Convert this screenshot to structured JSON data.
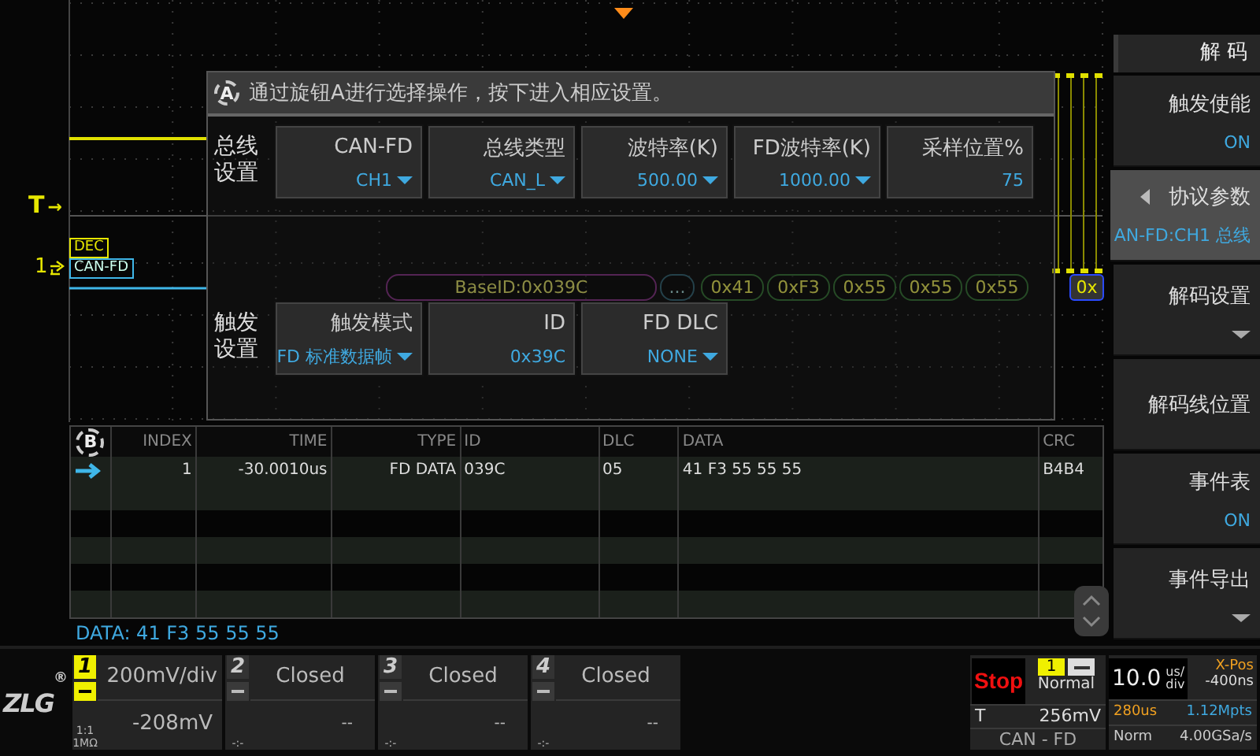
{
  "waveform": {
    "trigger_label": "T",
    "trigger_arrow": "→",
    "channel_label": "1",
    "decode_tags": [
      "DEC",
      "CAN-FD"
    ],
    "bus_segments": [
      {
        "kind": "id",
        "text": "BaseID:0x039C"
      },
      {
        "kind": "ctrl",
        "text": "..."
      },
      {
        "kind": "data",
        "text": "0x41"
      },
      {
        "kind": "data",
        "text": "0xF3"
      },
      {
        "kind": "data",
        "text": "0x55"
      },
      {
        "kind": "data",
        "text": "0x55"
      },
      {
        "kind": "data",
        "text": "0x55"
      },
      {
        "kind": "crc",
        "text": "0x"
      }
    ]
  },
  "dialog": {
    "knob_letter": "A",
    "hint": "通过旋钮A进行选择操作，按下进入相应设置。",
    "groups": [
      {
        "label": "总线设置",
        "fields": [
          {
            "label": "CAN-FD",
            "value": "CH1",
            "dropdown": true
          },
          {
            "label": "总线类型",
            "value": "CAN_L",
            "dropdown": true
          },
          {
            "label": "波特率(K)",
            "value": "500.00",
            "dropdown": true
          },
          {
            "label": "FD波特率(K)",
            "value": "1000.00",
            "dropdown": true
          },
          {
            "label": "采样位置%",
            "value": "75",
            "dropdown": false
          }
        ]
      },
      {
        "label": "触发设置",
        "fields": [
          {
            "label": "触发模式",
            "value": "FD 标准数据帧",
            "dropdown": true
          },
          {
            "label": "ID",
            "value": "0x39C",
            "dropdown": false
          },
          {
            "label": "FD DLC",
            "value": "NONE",
            "dropdown": true
          }
        ]
      }
    ]
  },
  "table": {
    "knob_letter": "B",
    "columns": [
      "INDEX",
      "TIME",
      "TYPE",
      "ID",
      "DLC",
      "DATA",
      "CRC"
    ],
    "rows": [
      {
        "selected": true,
        "cells": [
          "1",
          "-30.0010us",
          "FD DATA",
          "039C",
          "05",
          "41 F3 55 55 55",
          "B4B4"
        ]
      }
    ]
  },
  "detail": "DATA: 41 F3 55 55 55",
  "sidebar": {
    "title": "解 码",
    "items": [
      {
        "kind": "value",
        "label": "触发使能",
        "value": "ON",
        "selected": false
      },
      {
        "kind": "value",
        "label": "协议参数",
        "value": "AN-FD:CH1 总线",
        "selected": true
      },
      {
        "kind": "menu",
        "label": "解码设置",
        "selected": false
      },
      {
        "kind": "plain",
        "label": "解码线位置",
        "selected": false
      },
      {
        "kind": "value",
        "label": "事件表",
        "value": "ON",
        "selected": false
      },
      {
        "kind": "menu",
        "label": "事件导出",
        "selected": false
      }
    ]
  },
  "bottom": {
    "logo": "ZLG",
    "logo_mark": "®",
    "channels": [
      {
        "number": "1",
        "on": true,
        "scale": "200mV/div",
        "offset": "-208mV",
        "probe": "1:1",
        "impedance": "1MΩ"
      },
      {
        "number": "2",
        "on": false,
        "scale": "Closed",
        "offset": "--",
        "probe": "-:-"
      },
      {
        "number": "3",
        "on": false,
        "scale": "Closed",
        "offset": "--",
        "probe": "-:-"
      },
      {
        "number": "4",
        "on": false,
        "scale": "Closed",
        "offset": "--",
        "probe": "-:-"
      }
    ],
    "status": {
      "run_state": "Stop",
      "trigger_source": "1",
      "trigger_mode": "Normal",
      "trigger_label": "T",
      "trigger_level": "256mV",
      "trigger_type": "CAN - FD"
    },
    "timebase": {
      "value": "10.0",
      "unit_top": "us/",
      "unit_bottom": "div",
      "xpos_label": "X-Pos",
      "xpos": "-400ns",
      "length": "280us",
      "points": "1.12Mpts",
      "acq_mode": "Norm",
      "rate": "4.00GSa/s"
    }
  }
}
